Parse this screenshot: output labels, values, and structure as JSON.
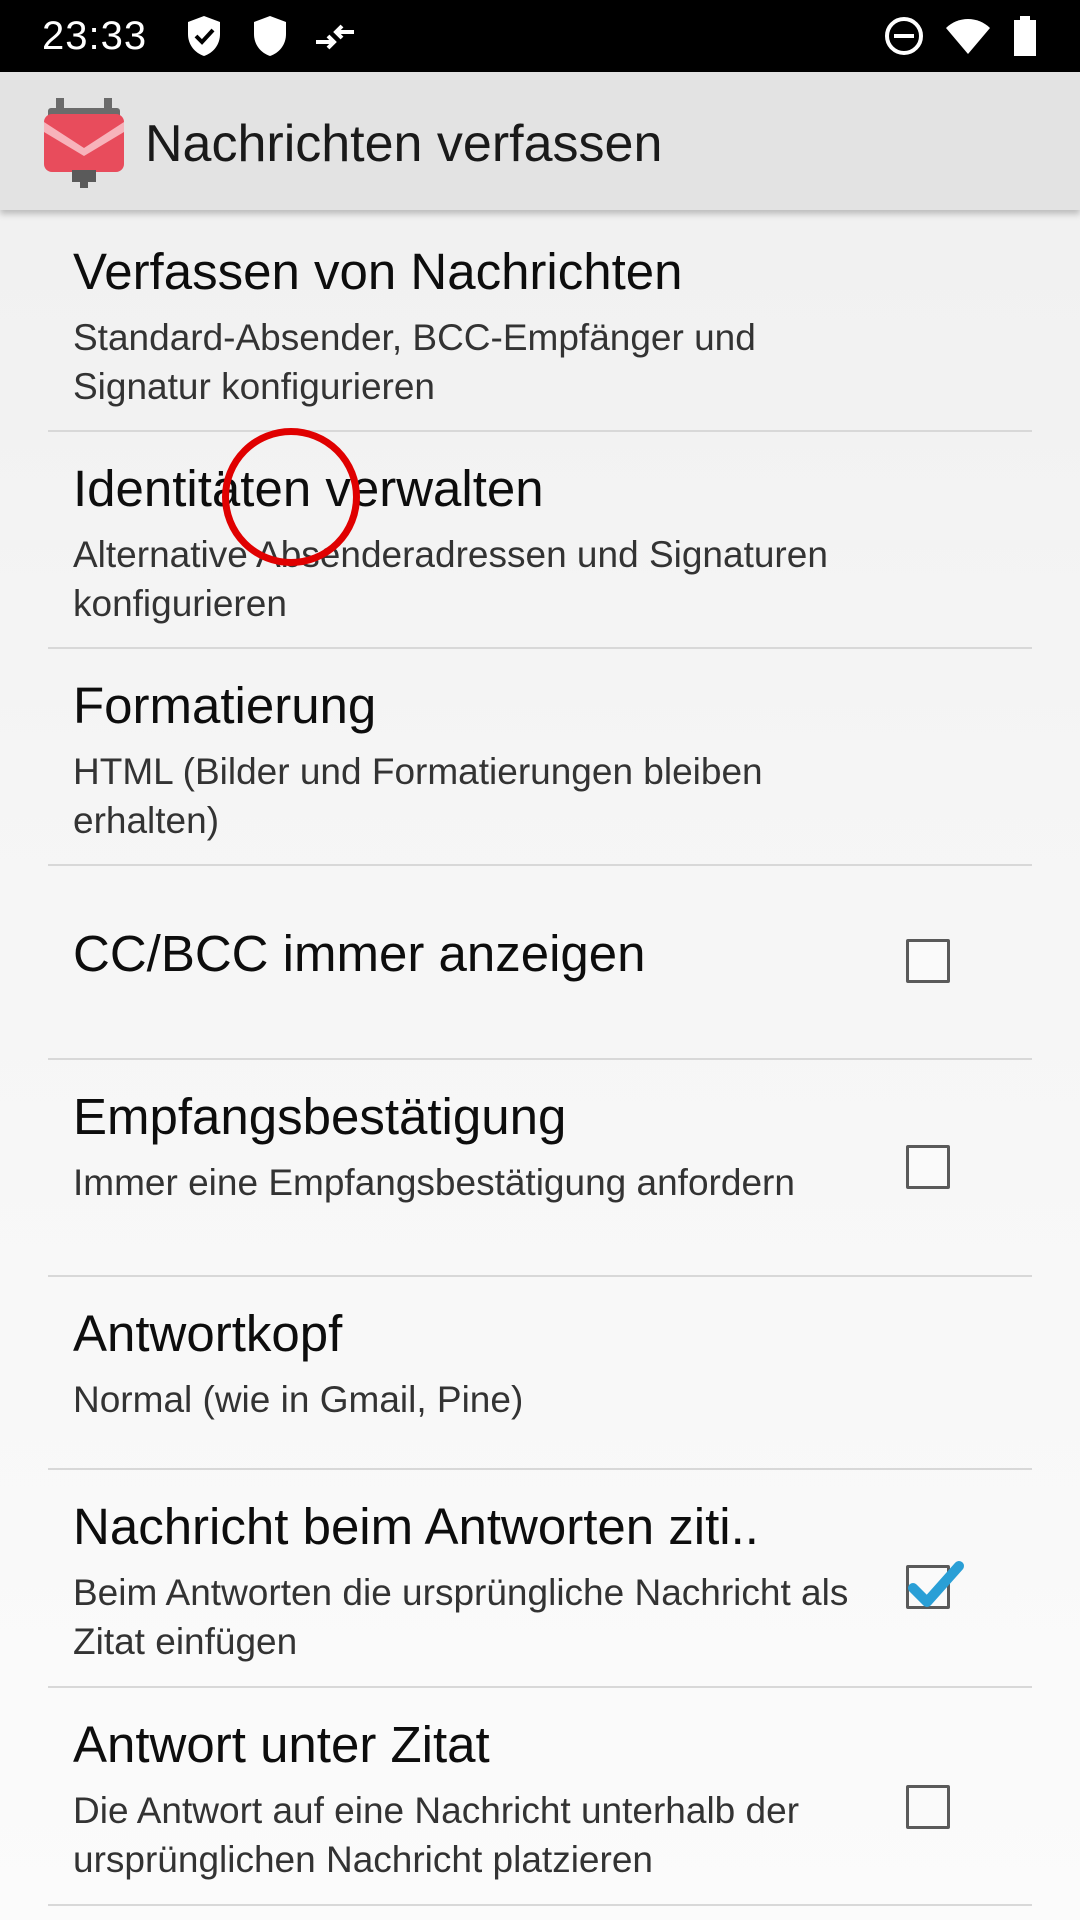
{
  "status_bar": {
    "time": "23:33",
    "left_icons": [
      "shield-check-icon",
      "shield-icon",
      "data-transfer-icon"
    ],
    "right_icons": [
      "do-not-disturb-icon",
      "wifi-icon",
      "battery-icon"
    ]
  },
  "app_bar": {
    "title": "Nachrichten verfassen",
    "logo_icon": "k9-mail-logo-icon",
    "logo_color": "#e84c5c"
  },
  "preferences": [
    {
      "title": "Verfassen von Nachrichten",
      "summary": "Standard-Absender, BCC-Empfänger und Signatur konfigurieren",
      "checkbox": null
    },
    {
      "title": "Identitäten verwalten",
      "summary": "Alternative Absenderadressen und Signaturen konfigurieren",
      "checkbox": null
    },
    {
      "title": "Formatierung",
      "summary": "HTML (Bilder und Formatierungen bleiben erhalten)",
      "checkbox": null
    },
    {
      "title": "CC/BCC immer anzeigen",
      "summary": "",
      "checkbox": false
    },
    {
      "title": "Empfangsbestätigung",
      "summary": "Immer eine Empfangsbestätigung anfordern",
      "checkbox": false
    },
    {
      "title": "Antwortkopf",
      "summary": "Normal (wie in Gmail, Pine)",
      "checkbox": null
    },
    {
      "title": "Nachricht beim Antworten ziti..",
      "summary": "Beim Antworten die ursprüngliche Nachricht als Zitat einfügen",
      "checkbox": true
    },
    {
      "title": "Antwort unter Zitat",
      "summary": "Die Antwort auf eine Nachricht unterhalb der ursprünglichen Nachricht platzieren",
      "checkbox": false
    }
  ],
  "colors": {
    "status_bar_bg": "#000000",
    "app_bar_bg": "#e3e3e3",
    "checkmark": "#2a9fd6",
    "touch_indicator": "#e00000"
  }
}
